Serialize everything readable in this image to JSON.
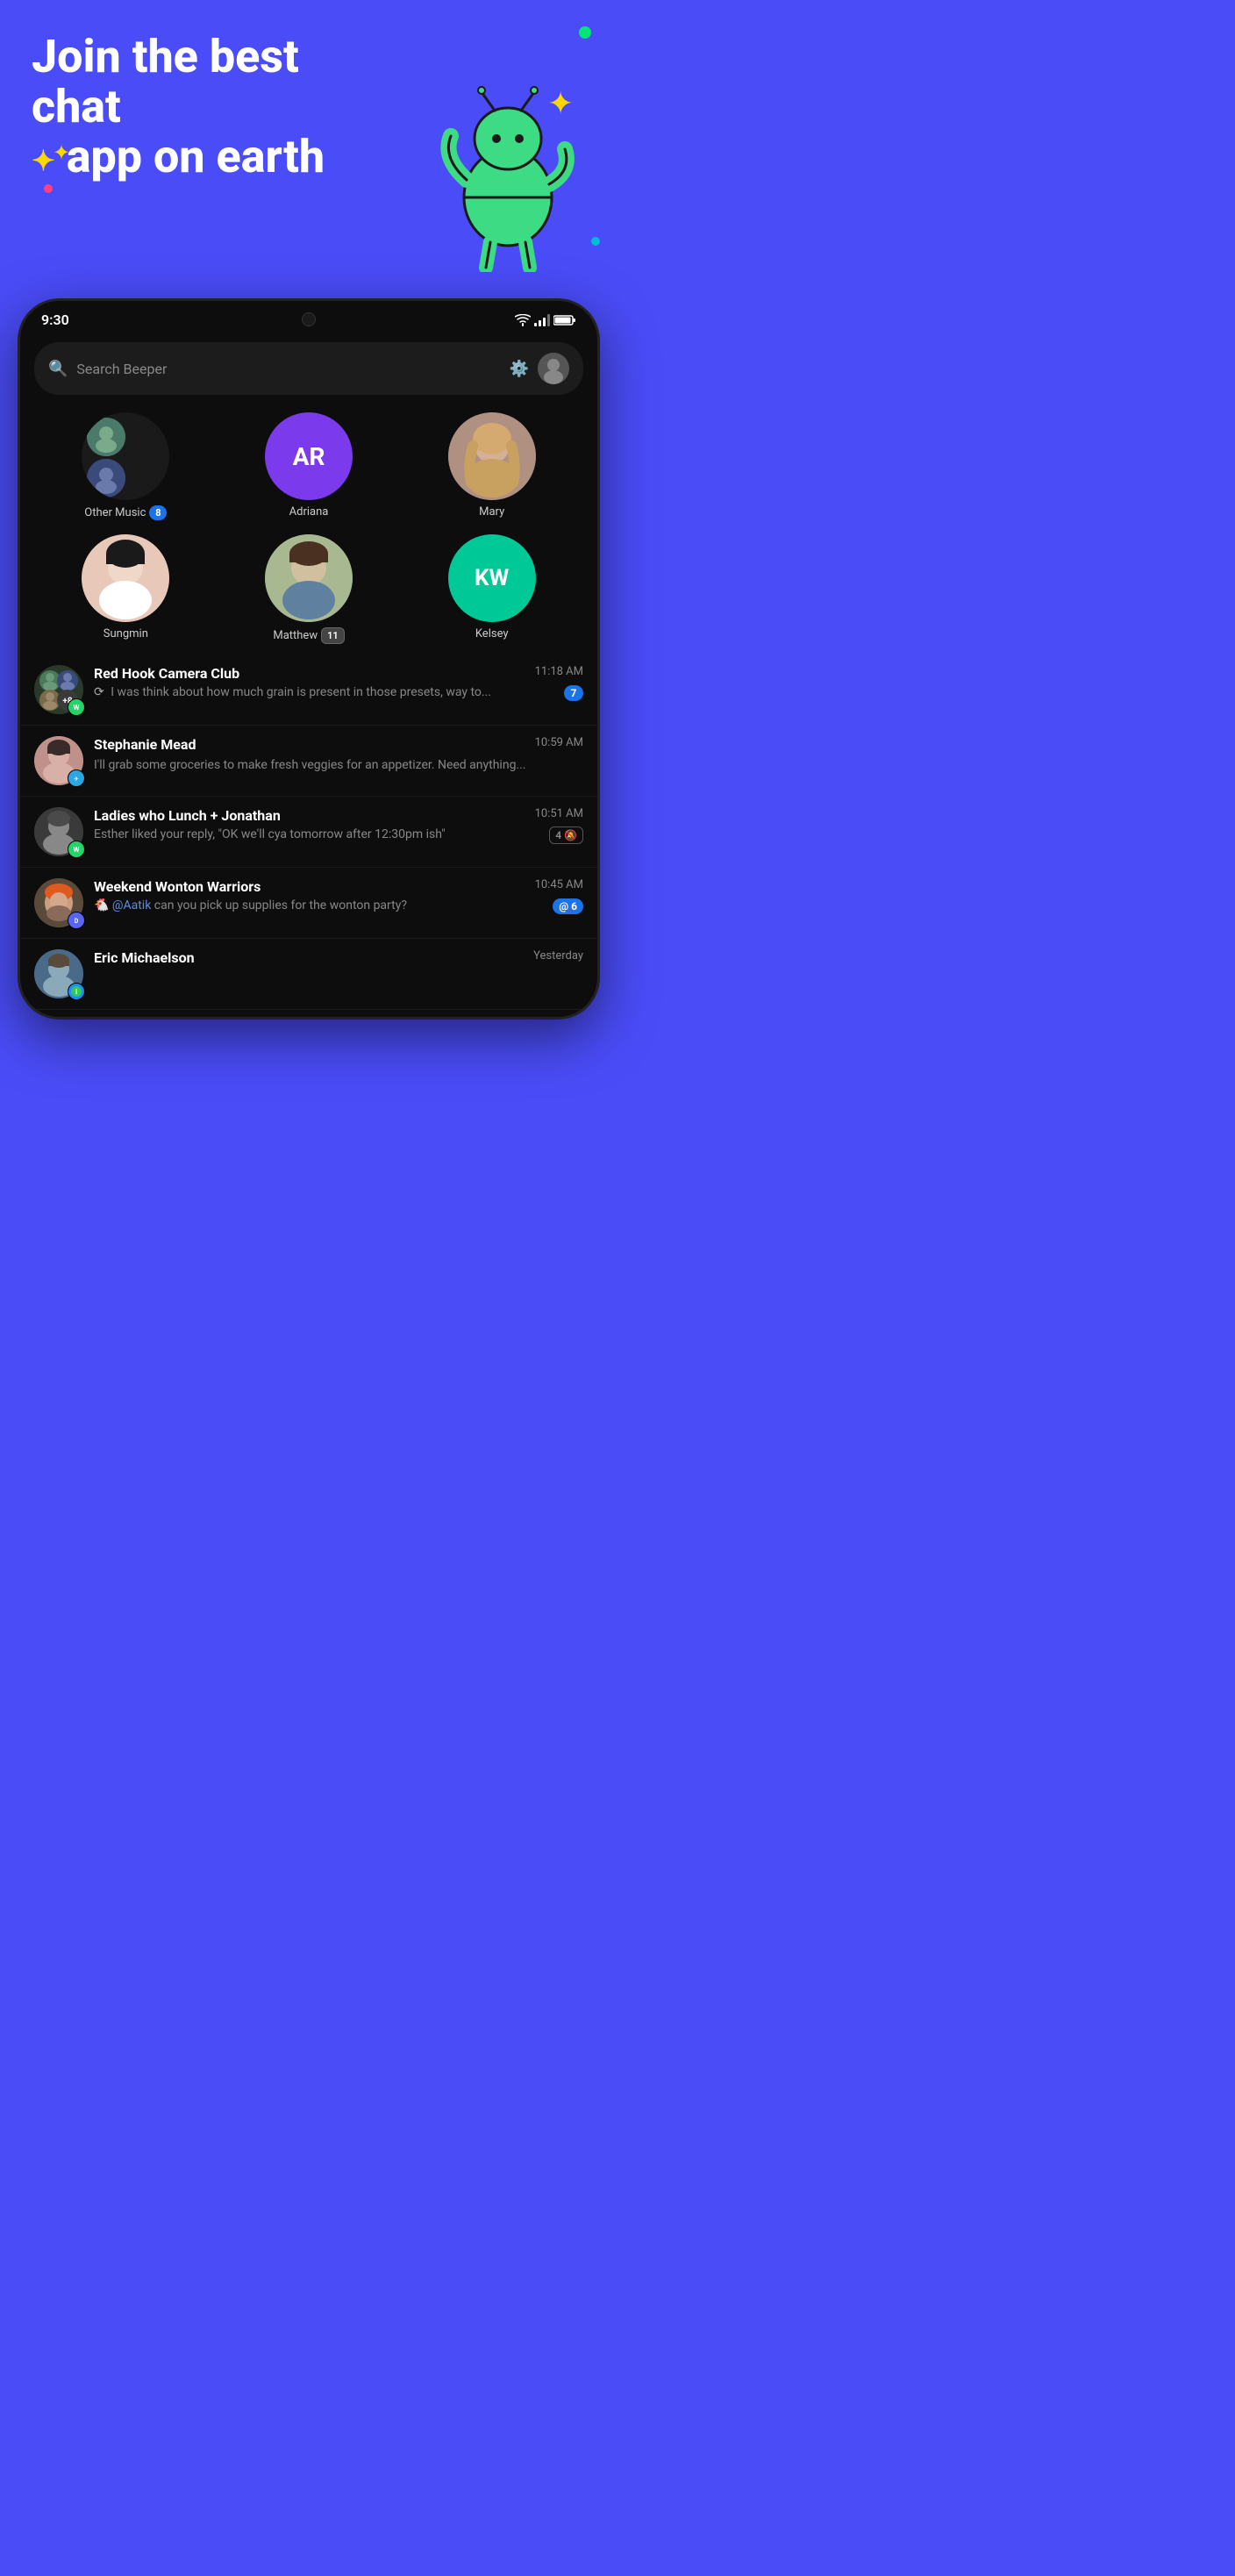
{
  "hero": {
    "title_line1": "Join the best chat",
    "title_line2": "app on earth"
  },
  "status_bar": {
    "time": "9:30"
  },
  "search": {
    "placeholder": "Search Beeper"
  },
  "pinned_contacts": [
    {
      "id": "other-music",
      "label": "Other Music",
      "badge": "8",
      "type": "group"
    },
    {
      "id": "adriana",
      "label": "Adriana",
      "initials": "AR",
      "type": "initials",
      "color": "#7c3aed"
    },
    {
      "id": "mary",
      "label": "Mary",
      "type": "photo"
    }
  ],
  "pinned_contacts_row2": [
    {
      "id": "sungmin",
      "label": "Sungmin",
      "type": "photo"
    },
    {
      "id": "matthew",
      "label": "Matthew",
      "badge": "11",
      "type": "photo"
    },
    {
      "id": "kelsey",
      "label": "Kelsey",
      "initials": "KW",
      "type": "initials",
      "color": "#00c896"
    }
  ],
  "chats": [
    {
      "id": "red-hook-camera-club",
      "name": "Red Hook Camera Club",
      "time": "11:18 AM",
      "preview": "I was think about how much grain is present in those presets, way to...",
      "badge": "7",
      "badge_type": "count",
      "platform": "whatsapp",
      "members_count": "+8",
      "has_typing": true
    },
    {
      "id": "stephanie-mead",
      "name": "Stephanie Mead",
      "time": "10:59 AM",
      "preview": "I'll grab some groceries to make fresh veggies for an appetizer. Need anything...",
      "badge": "",
      "badge_type": "none",
      "platform": "telegram"
    },
    {
      "id": "ladies-who-lunch",
      "name": "Ladies who Lunch + Jonathan",
      "time": "10:51 AM",
      "preview": "Esther liked your reply, \"OK we'll cya tomorrow after 12:30pm ish\"",
      "badge": "4",
      "badge_type": "muted",
      "platform": "whatsapp"
    },
    {
      "id": "weekend-wonton-warriors",
      "name": "Weekend Wonton Warriors",
      "time": "10:45 AM",
      "preview": "@Aatik can you pick up supplies for the wonton party?",
      "badge": "@ 6",
      "badge_type": "mention",
      "platform": "discord"
    },
    {
      "id": "eric-michaelson",
      "name": "Eric Michaelson",
      "time": "Yesterday",
      "preview": "",
      "badge": "",
      "badge_type": "none",
      "platform": "imessage"
    }
  ]
}
